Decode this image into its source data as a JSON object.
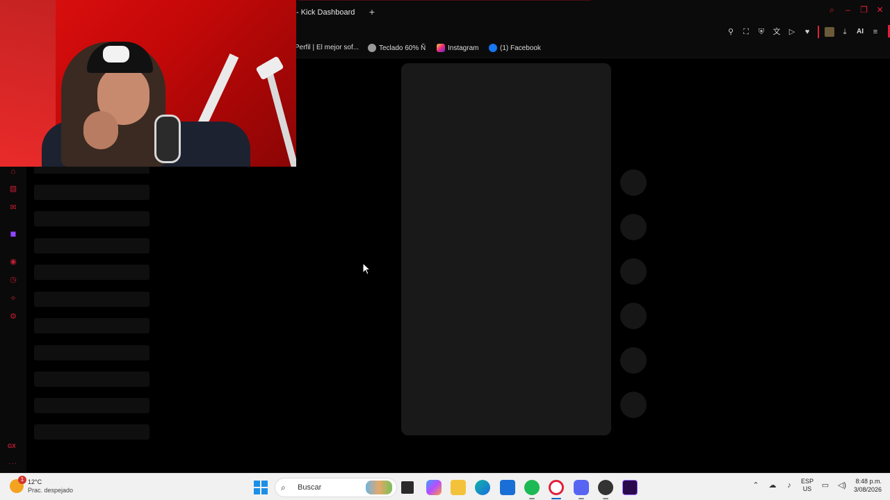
{
  "browser": {
    "tab_title": "- Kick Dashboard",
    "new_tab": "+"
  },
  "bookmarks": [
    {
      "label": "Perfil | El mejor sof...",
      "icon": "page-icon"
    },
    {
      "label": "Teclado 60% Ñ",
      "icon": "globe-icon"
    },
    {
      "label": "Instagram",
      "icon": "instagram-icon"
    },
    {
      "label": "(1) Facebook",
      "icon": "facebook-icon"
    }
  ],
  "toolbar": {
    "ai_label": "AI"
  },
  "sidebar": {
    "gx_label": "GX",
    "more_label": "···"
  },
  "taskbar": {
    "weather_temp": "12°C",
    "weather_desc": "Prac. despejado",
    "weather_badge": "1",
    "search_placeholder": "Buscar",
    "lang_top": "ESP",
    "lang_bottom": "US",
    "time": "8:48 p.m.",
    "date": "3/08/2026"
  },
  "colors": {
    "accent": "#e0203a",
    "panel": "#191919",
    "background": "#000000"
  }
}
